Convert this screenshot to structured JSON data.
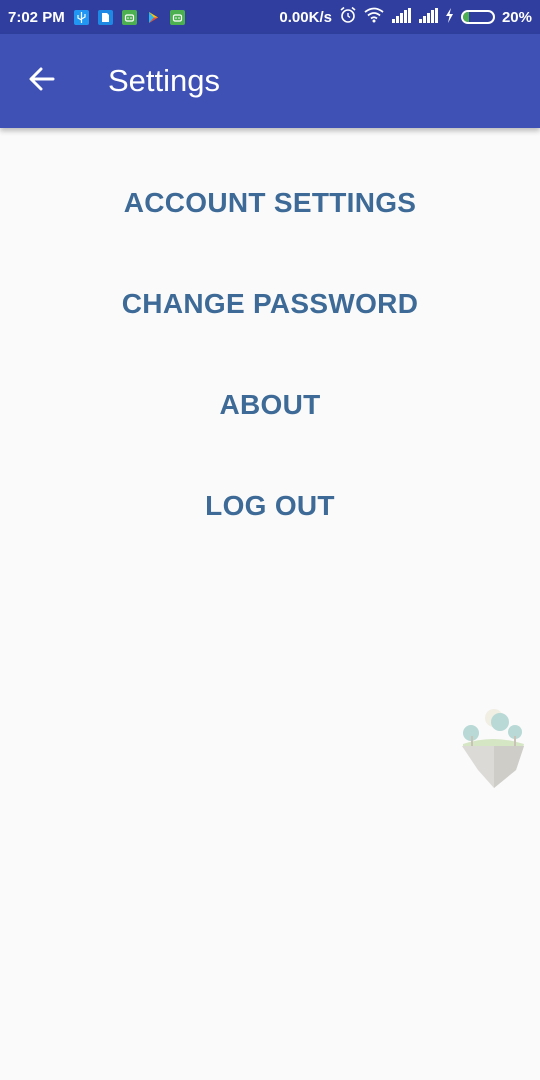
{
  "status_bar": {
    "time": "7:02 PM",
    "network_speed": "0.00K/s",
    "battery_percent": "20%",
    "battery_level": 0.2,
    "notification_icons": [
      "usb-icon",
      "file-icon",
      "android-icon",
      "play-store-icon",
      "android-icon"
    ],
    "system_icons": [
      "alarm-icon",
      "wifi-icon",
      "signal-icon",
      "signal-icon",
      "charging-icon",
      "battery-icon"
    ]
  },
  "app_bar": {
    "title": "Settings",
    "back_icon": "arrow-back-icon",
    "color": "#3f51b5"
  },
  "menu": {
    "items": [
      {
        "label": "ACCOUNT SETTINGS"
      },
      {
        "label": "CHANGE PASSWORD"
      },
      {
        "label": "ABOUT"
      },
      {
        "label": "LOG OUT"
      }
    ],
    "text_color": "#3d6a96"
  },
  "decoration": {
    "icon": "floating-island-icon"
  }
}
